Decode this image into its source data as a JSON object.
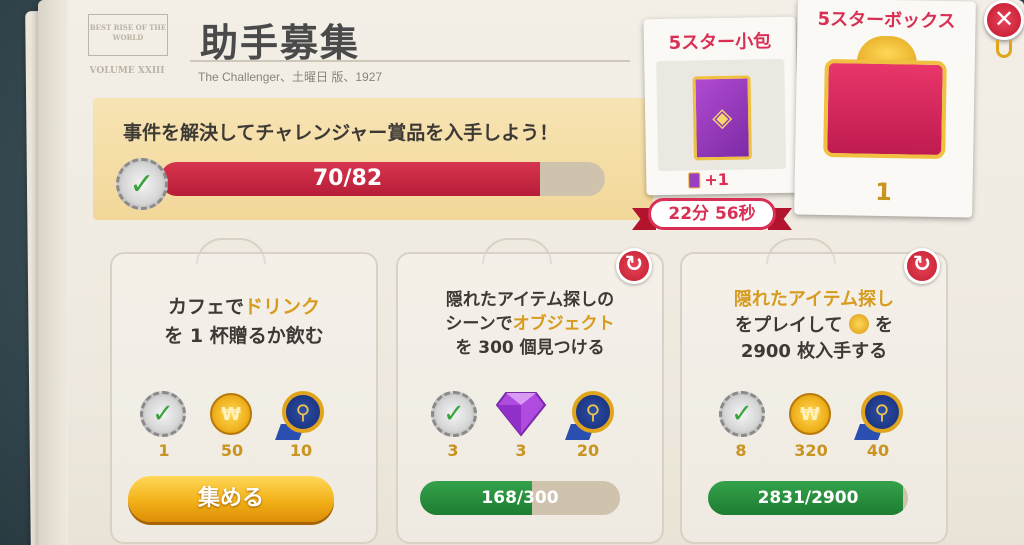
{
  "header": {
    "masthead": "BEST RISE OF THE WORLD",
    "masthead_small": "VOLUME XXIII",
    "title": "助手募集",
    "subtitle": "The Challenger、土曜日 版、1927"
  },
  "challenge": {
    "text": "事件を解決してチャレンジャー賞品を入手しよう！",
    "progress_text": "70/82",
    "progress_fraction": 0.854
  },
  "rewards_panel": {
    "pack_title": "5スター小包",
    "pack_plus": "+1",
    "timer": "22分 56秒",
    "box_title": "5スターボックス",
    "box_count": "1"
  },
  "tasks": [
    {
      "line1_pre": "カフェで",
      "line1_hl": "ドリンク",
      "line1_post": "",
      "line2": "を 1 杯贈るか飲む",
      "rewards": [
        "1",
        "50",
        "10"
      ],
      "button_label": "集める"
    },
    {
      "line1_pre": "隠れたアイテム探しの",
      "line2_pre": "シーンで",
      "line2_hl": "オブジェクト",
      "line3": "を 300 個見つける",
      "rewards": [
        "3",
        "3",
        "20"
      ],
      "progress_text": "168/300",
      "progress_fraction": 0.56
    },
    {
      "line1_hl": "隠れたアイテム探し",
      "line2_pre": "をプレイして",
      "line2_post": "を",
      "line3": "2900 枚入手する",
      "rewards": [
        "8",
        "320",
        "40"
      ],
      "progress_text": "2831/2900",
      "progress_fraction": 0.976
    }
  ],
  "icons": {
    "check": "✓",
    "coin": "₩",
    "refresh": "↻",
    "close": "✕",
    "magnifier": "⚲"
  },
  "colors": {
    "accent_red": "#d92f54",
    "gold": "#c9941f",
    "green": "#1d7d32"
  }
}
